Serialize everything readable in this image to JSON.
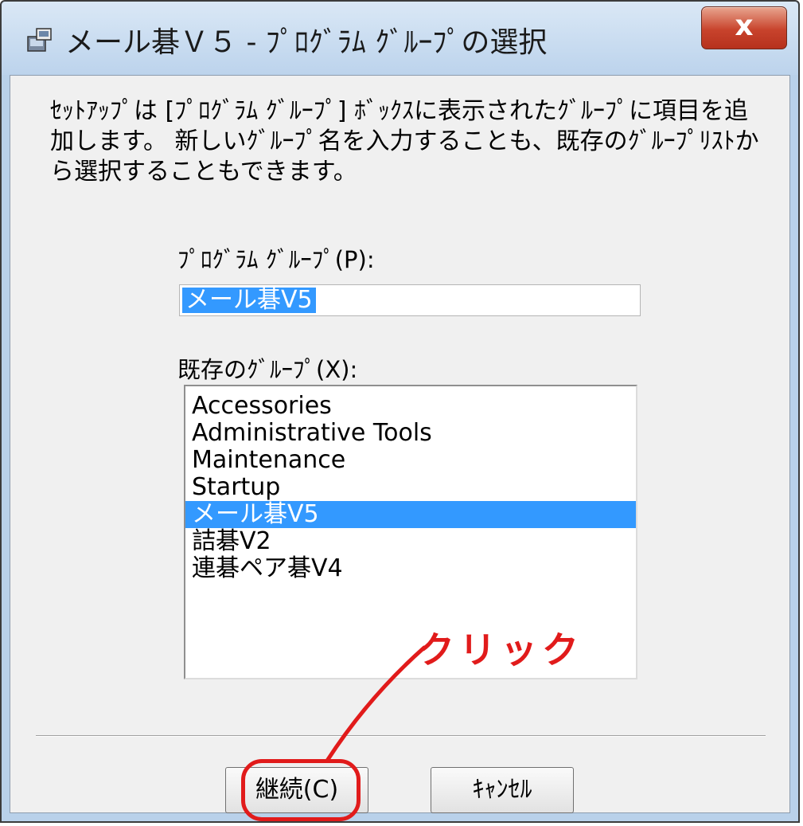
{
  "window": {
    "title": "メール碁Ｖ５ - ﾌﾟﾛｸﾞﾗﾑ ｸﾞﾙｰﾌﾟの選択",
    "close_label": "x"
  },
  "dialog": {
    "description": "ｾｯﾄｱｯﾌﾟは [ﾌﾟﾛｸﾞﾗﾑ ｸﾞﾙｰﾌﾟ] ﾎﾞｯｸｽに表示されたｸﾞﾙｰﾌﾟに項目を追加します。 新しいｸﾞﾙｰﾌﾟ名を入力することも、既存のｸﾞﾙｰﾌﾟﾘｽﾄから選択することもできます。",
    "program_group_label": "ﾌﾟﾛｸﾞﾗﾑ ｸﾞﾙｰﾌﾟ(P):",
    "program_group_value": "メール碁V5",
    "existing_groups_label": "既存のｸﾞﾙｰﾌﾟ(X):",
    "groups": [
      {
        "label": "Accessories"
      },
      {
        "label": "Administrative Tools"
      },
      {
        "label": "Maintenance"
      },
      {
        "label": "Startup"
      },
      {
        "label": "メール碁V5"
      },
      {
        "label": "詰碁V2"
      },
      {
        "label": "連碁ペア碁V4"
      }
    ],
    "selected_group": "メール碁V5",
    "continue_label": "継続(C)",
    "cancel_label": "ｷｬﾝｾﾙ"
  },
  "annotation": {
    "text": "クリック",
    "color": "#e11b1b"
  },
  "colors": {
    "selection": "#3399ff",
    "close_button": "#c8432c"
  }
}
